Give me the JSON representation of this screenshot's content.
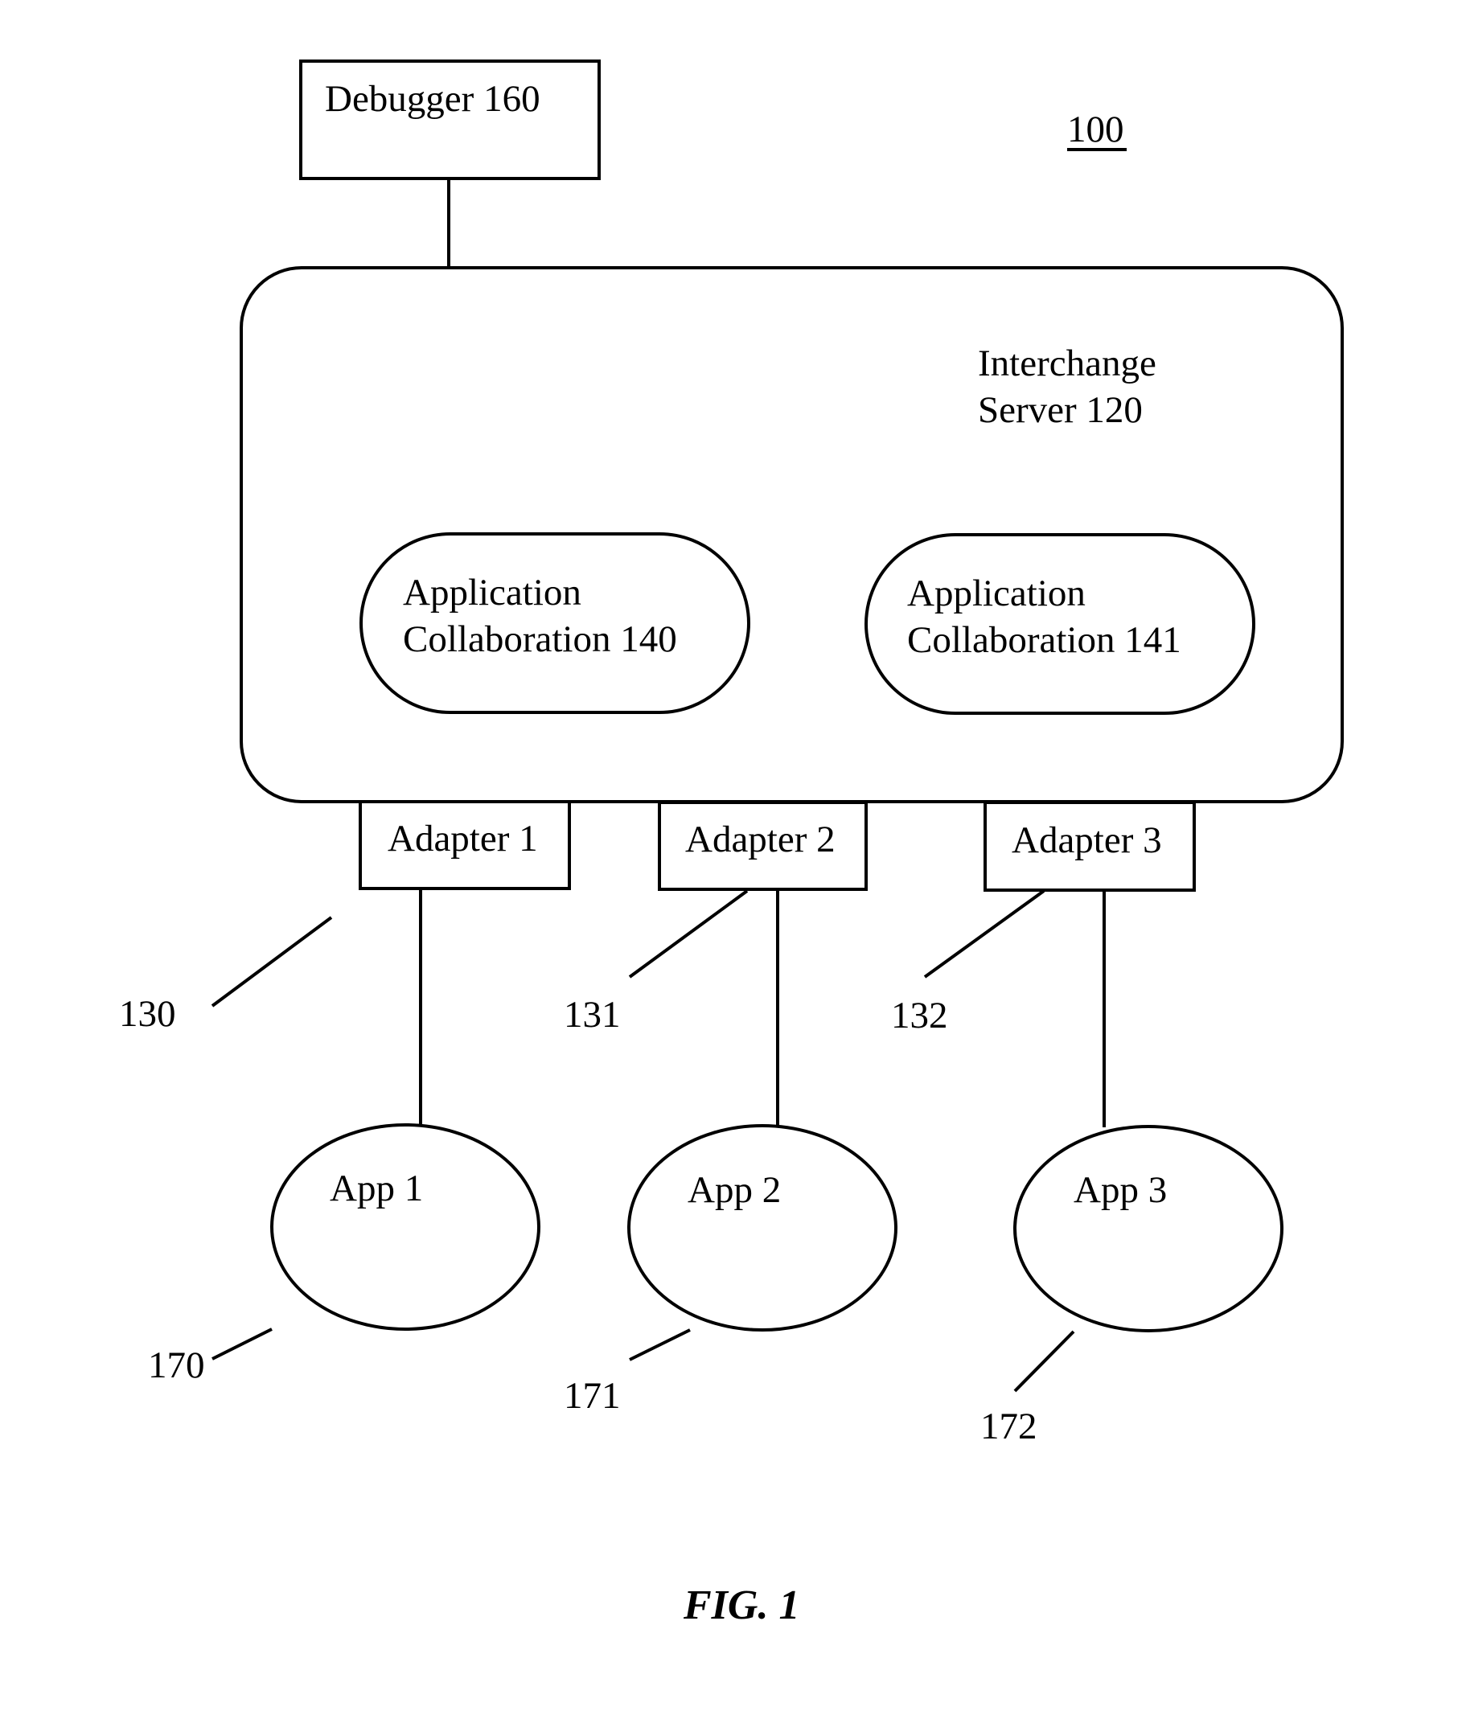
{
  "figure": {
    "system_ref": "100",
    "caption": "FIG. 1"
  },
  "debugger": {
    "label": "Debugger 160"
  },
  "server": {
    "line1": "Interchange",
    "line2": "Server 120"
  },
  "collaborations": [
    {
      "line1": "Application",
      "line2": "Collaboration 140"
    },
    {
      "line1": "Application",
      "line2": "Collaboration 141"
    }
  ],
  "adapters": [
    {
      "label": "Adapter 1",
      "ref": "130"
    },
    {
      "label": "Adapter 2",
      "ref": "131"
    },
    {
      "label": "Adapter 3",
      "ref": "132"
    }
  ],
  "apps": [
    {
      "label": "App 1",
      "ref": "170"
    },
    {
      "label": "App 2",
      "ref": "171"
    },
    {
      "label": "App 3",
      "ref": "172"
    }
  ]
}
